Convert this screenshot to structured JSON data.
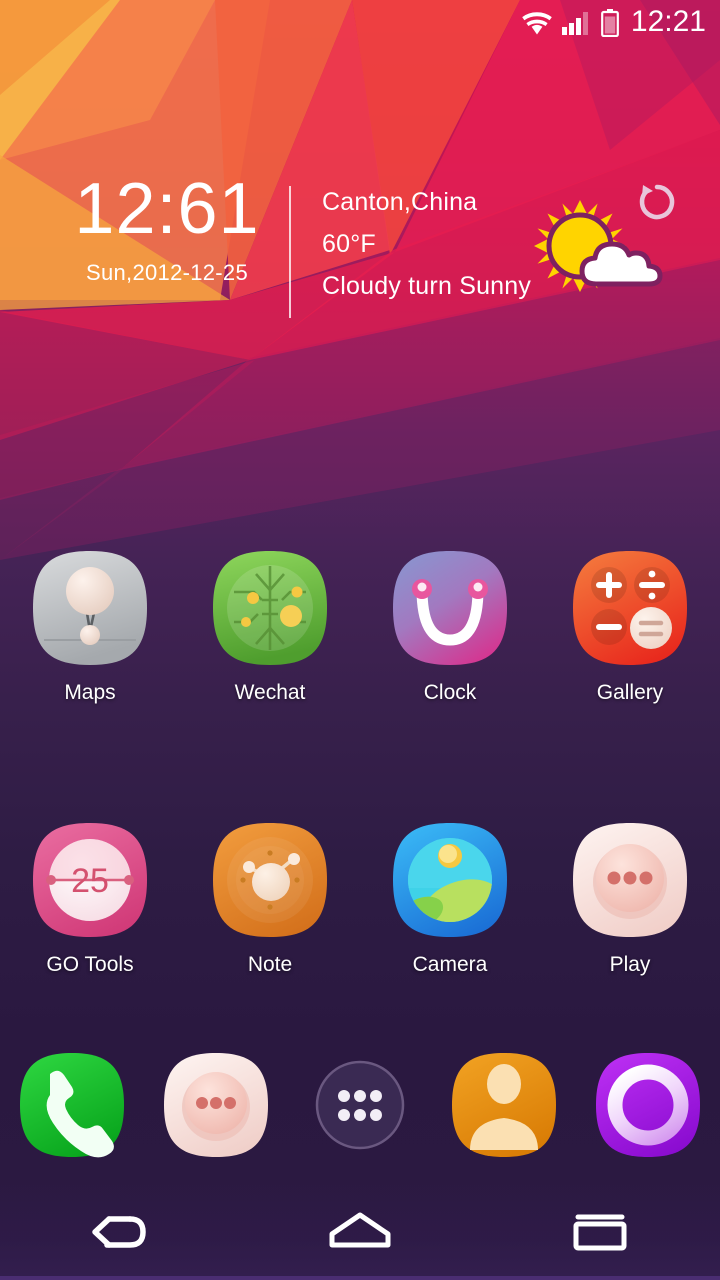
{
  "status_bar": {
    "time": "12:21",
    "icons": [
      "wifi-icon",
      "signal-icon",
      "battery-icon"
    ],
    "text_color": "#ffffff"
  },
  "widget": {
    "clock": {
      "time": "12:61",
      "date": "Sun,2012-12-25"
    },
    "weather": {
      "location": "Canton,China",
      "temperature": "60°F",
      "condition": "Cloudy turn Sunny",
      "icon": "sun-behind-cloud-icon",
      "refresh_icon": "refresh-icon"
    }
  },
  "app_grid": {
    "rows": [
      [
        {
          "label": "Maps",
          "icon": "maps-icon",
          "color": "#b9bcc0"
        },
        {
          "label": "Wechat",
          "icon": "wechat-icon",
          "color": "#6cc24a"
        },
        {
          "label": "Clock",
          "icon": "clock-icon",
          "color": "#8e7ac4"
        },
        {
          "label": "Gallery",
          "icon": "gallery-icon",
          "color": "#f04a23"
        }
      ],
      [
        {
          "label": "GO Tools",
          "icon": "go-tools-icon",
          "color": "#e0558c"
        },
        {
          "label": "Note",
          "icon": "note-icon",
          "color": "#e08a2e"
        },
        {
          "label": "Camera",
          "icon": "camera-icon",
          "color": "#2196f3"
        },
        {
          "label": "Play",
          "icon": "play-icon",
          "color": "#f6d5d0"
        }
      ]
    ]
  },
  "dock": {
    "items": [
      {
        "name": "phone",
        "icon": "phone-icon",
        "color": "#15b52b"
      },
      {
        "name": "messaging",
        "icon": "messaging-icon",
        "color": "#f6d5d0"
      },
      {
        "name": "app-drawer",
        "icon": "app-drawer-icon",
        "color": "#3c2b55"
      },
      {
        "name": "contacts",
        "icon": "contacts-icon",
        "color": "#e8940f"
      },
      {
        "name": "browser",
        "icon": "browser-icon",
        "color": "#a01ae0"
      }
    ]
  },
  "nav_bar": {
    "buttons": [
      {
        "name": "back",
        "icon": "back-arrow-icon"
      },
      {
        "name": "home",
        "icon": "home-icon"
      },
      {
        "name": "recents",
        "icon": "recents-icon"
      }
    ]
  }
}
